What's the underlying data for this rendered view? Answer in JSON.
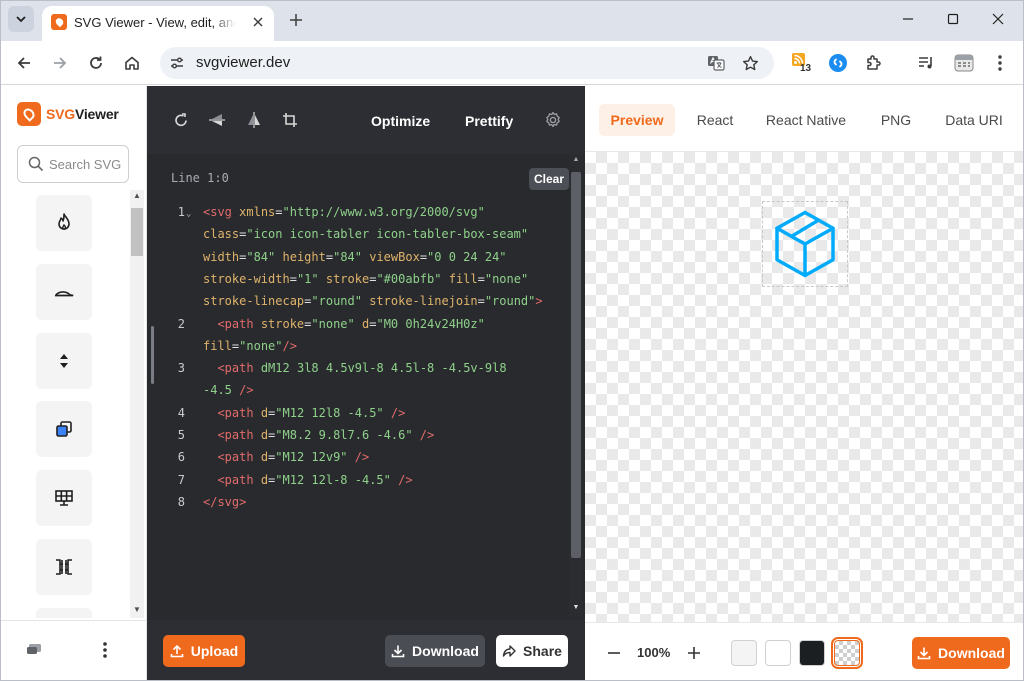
{
  "browser": {
    "tab_title": "SVG Viewer - View, edit, and optimize SVGs",
    "url": "svgviewer.dev",
    "extension_badge": "13",
    "accent": "#0b57d0"
  },
  "app": {
    "logo_prefix": "SVG",
    "logo_suffix": "Viewer",
    "brand_color": "#f06a1d"
  },
  "sidebar": {
    "search_placeholder": "Search SVG",
    "icons": [
      "fire-icon",
      "cap-icon",
      "sort-icon",
      "layers-icon",
      "table-icon",
      "layout-icon"
    ]
  },
  "editor": {
    "toolbar": {
      "optimize_label": "Optimize",
      "prettify_label": "Prettify"
    },
    "line_indicator": "Line 1:0",
    "clear_label": "Clear",
    "lines": [
      {
        "num": "1",
        "text": "<svg xmlns=\"http://www.w3.org/2000/svg\""
      },
      {
        "num": "",
        "text": "class=\"icon icon-tabler icon-tabler-box-seam\""
      },
      {
        "num": "",
        "text": "width=\"84\" height=\"84\" viewBox=\"0 0 24 24\""
      },
      {
        "num": "",
        "text": "stroke-width=\"1\" stroke=\"#00abfb\" fill=\"none\""
      },
      {
        "num": "",
        "text": "stroke-linecap=\"round\" stroke-linejoin=\"round\">"
      },
      {
        "num": "2",
        "text": "  <path stroke=\"none\" d=\"M0 0h24v24H0z\""
      },
      {
        "num": "",
        "text": "fill=\"none\"/>"
      },
      {
        "num": "3",
        "text": "  <path d=\"M12 3l8 4.5v9l-8 4.5l-8 -4.5v-9l8"
      },
      {
        "num": "",
        "text": "-4.5\" />"
      },
      {
        "num": "4",
        "text": "  <path d=\"M12 12l8 -4.5\" />"
      },
      {
        "num": "5",
        "text": "  <path d=\"M8.2 9.8l7.6 -4.6\" />"
      },
      {
        "num": "6",
        "text": "  <path d=\"M12 12v9\" />"
      },
      {
        "num": "7",
        "text": "  <path d=\"M12 12l-8 -4.5\" />"
      },
      {
        "num": "8",
        "text": "</svg>"
      }
    ],
    "footer": {
      "upload_label": "Upload",
      "download_label": "Download",
      "share_label": "Share"
    }
  },
  "preview": {
    "tabs": [
      "Preview",
      "React",
      "React Native",
      "PNG",
      "Data URI"
    ],
    "active_tab": "Preview",
    "icon_stroke": "#00abfb",
    "zoom": "100%",
    "background_swatches": [
      "#f4f4f5",
      "#ffffff",
      "#1c1f22",
      "checker"
    ],
    "download_label": "Download"
  }
}
